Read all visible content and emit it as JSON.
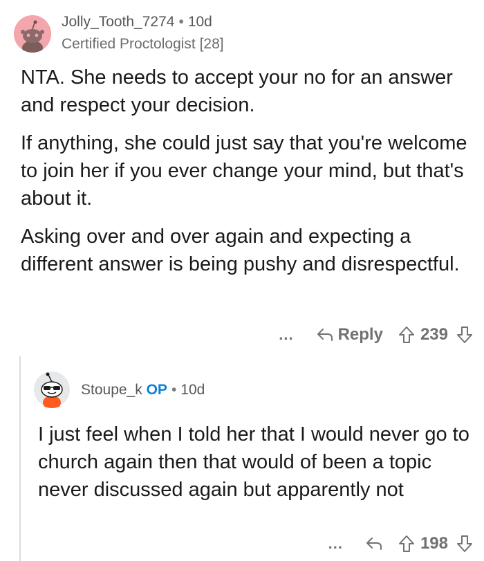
{
  "comments": [
    {
      "username": "Jolly_Tooth_7274",
      "separator": "•",
      "age": "10d",
      "flair": "Certified Proctologist [28]",
      "paragraphs": [
        "NTA. She needs to accept your no for an answer and respect your decision.",
        "If anything, she could just say that you're welcome to join her if you ever change your mind, but that's about it.",
        "Asking over and over again and expecting a different answer is being pushy and disrespectful."
      ],
      "more": "...",
      "reply_label": "Reply",
      "score": "239"
    },
    {
      "username": "Stoupe_k",
      "op_badge": "OP",
      "separator": "•",
      "age": "10d",
      "paragraphs": [
        "I just feel when I told her that I would never go to church again then that would of been a topic never discussed again but apparently not"
      ],
      "more": "...",
      "score": "198"
    }
  ],
  "colors": {
    "op": "#0f7fd4",
    "muted": "#6f7173",
    "avatar1_bg": "#f3a6ac"
  },
  "icons": [
    "reply-arrow-icon",
    "upvote-icon",
    "downvote-icon",
    "more-options-icon"
  ]
}
